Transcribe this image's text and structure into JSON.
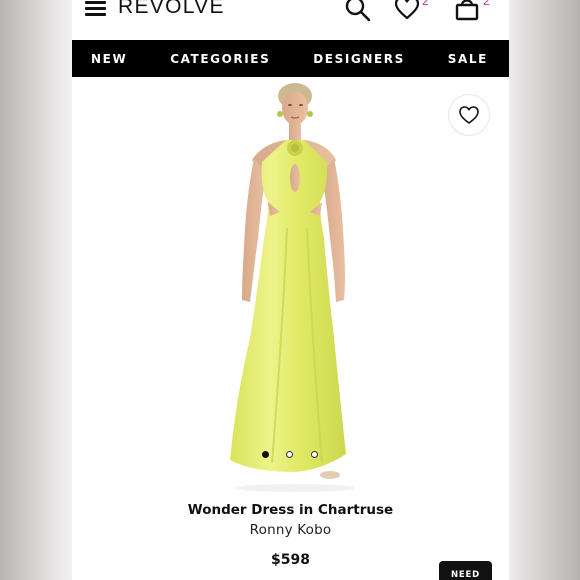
{
  "header": {
    "logo": "REVOLVE",
    "wishlist_count": "2",
    "bag_count": "2",
    "icons": [
      "menu-icon",
      "search-icon",
      "heart-icon",
      "shopping-bag-icon"
    ]
  },
  "nav": {
    "items": [
      "NEW",
      "CATEGORIES",
      "DESIGNERS",
      "SALE"
    ]
  },
  "product": {
    "name": "Wonder Dress in Chartruse",
    "brand": "Ronny Kobo",
    "price": "$598",
    "image_count": 3,
    "active_image": 1,
    "dress_color": "#e3ea6a"
  },
  "floating": {
    "need_help_label": "NEED"
  },
  "colors": {
    "nav_bg": "#000000",
    "badge": "#c2359c"
  }
}
